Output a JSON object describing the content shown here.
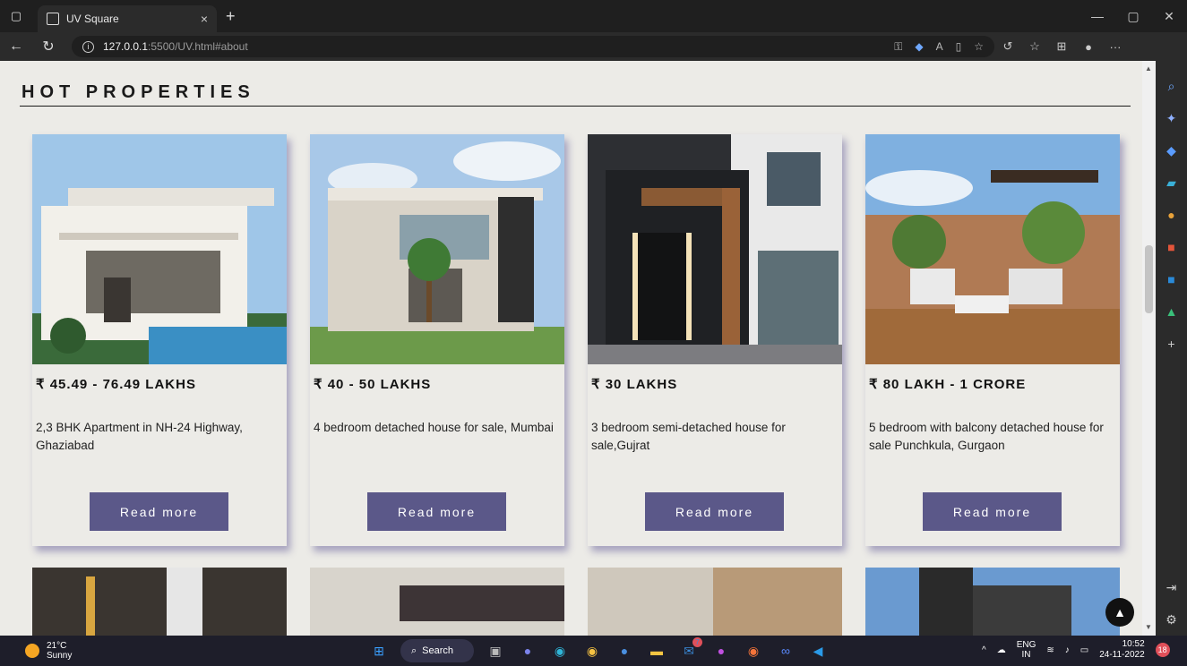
{
  "browser": {
    "tab_title": "UV Square",
    "tab_close": "×",
    "new_tab": "+",
    "url_host": "127.0.0.1",
    "url_rest": ":5500/UV.html#about",
    "minimize": "—",
    "restore": "▢",
    "close": "✕",
    "menu": "···"
  },
  "page": {
    "section_title": "HOT PROPERTIES",
    "cards": [
      {
        "price": "₹ 45.49 - 76.49 LAKHS",
        "desc": "2,3 BHK Apartment in NH-24 Highway, Ghaziabad",
        "button": "Read more"
      },
      {
        "price": "₹ 40 - 50 LAKHS",
        "desc": "4 bedroom detached house for sale, Mumbai",
        "button": "Read more"
      },
      {
        "price": "₹ 30 LAKHS",
        "desc": "3 bedroom semi-detached house for sale,Gujrat",
        "button": "Read more"
      },
      {
        "price": "₹ 80 LAKH - 1 CRORE",
        "desc": "5 bedroom with balcony detached house for sale Punchkula, Gurgaon",
        "button": "Read more"
      }
    ],
    "scroll_top_icon": "▲"
  },
  "taskbar": {
    "temperature": "21°C",
    "condition": "Sunny",
    "search_label": "Search",
    "language_top": "ENG",
    "language_bottom": "IN",
    "time": "10:52",
    "date": "24-11-2022",
    "notification_count": "18",
    "mail_badge": "7"
  },
  "colors": {
    "accent_button": "#5b5889",
    "page_bg": "#ecebe7"
  }
}
